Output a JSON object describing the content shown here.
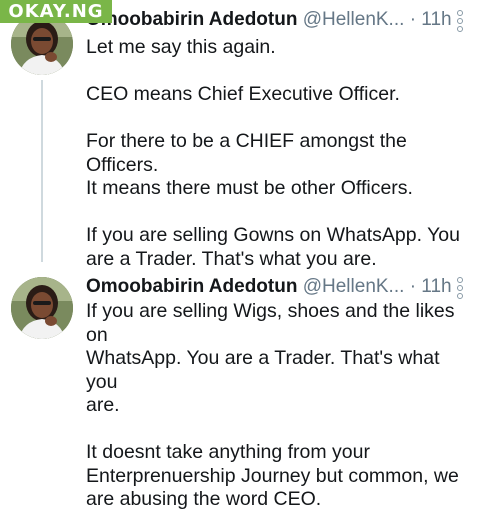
{
  "watermark": "OKAY.NG",
  "tweets": [
    {
      "name": "Omoobabirin Adedotun",
      "handle": "@HellenK...",
      "dot": "·",
      "time": "11h",
      "paragraphs": [
        "Let me say this again.",
        "CEO means Chief Executive Officer.",
        "For there to be a CHIEF amongst the Officers.\nIt means there must be other Officers.",
        "If you are selling Gowns on WhatsApp. You\nare a Trader.  That's what you are."
      ]
    },
    {
      "name": "Omoobabirin Adedotun",
      "handle": "@HellenK...",
      "dot": "·",
      "time": "11h",
      "paragraphs": [
        "If you are selling Wigs, shoes and the likes on\nWhatsApp. You are a Trader.  That's what you\nare.",
        "It doesnt take anything from your\nEnterprenuership Journey but common, we\nare abusing the word CEO."
      ]
    }
  ]
}
